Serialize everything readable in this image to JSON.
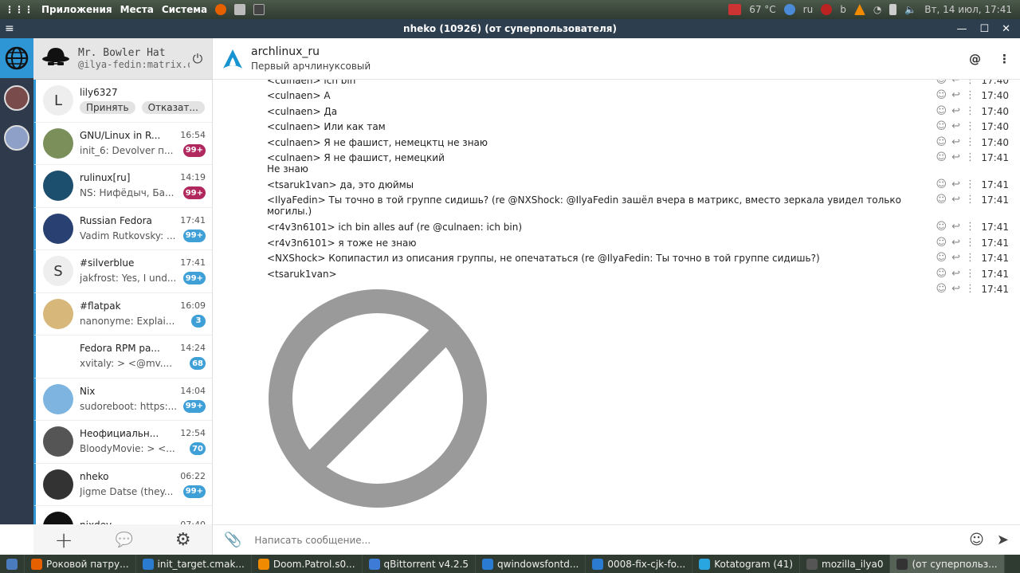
{
  "system_panel": {
    "menus": [
      "Приложения",
      "Места",
      "Система"
    ],
    "temperature": "67 °C",
    "keyboard_layout": "ru",
    "datetime": "Вт, 14 июл, 17:41",
    "tray_letter": "b"
  },
  "window": {
    "title": "nheko (10926) (от суперпользователя)",
    "hamburger": "≡",
    "min": "—",
    "max": "☐",
    "close": "✕"
  },
  "user": {
    "display_name": "Mr. Bowler Hat",
    "user_id": "@ilya-fedin:matrix.o",
    "logout_icon": "⏻"
  },
  "rooms": [
    {
      "name": "lily6327",
      "avatar_letter": "L",
      "invite": true,
      "accept": "Принять",
      "decline": "Отказат..."
    },
    {
      "name": "GNU/Linux in R...",
      "time": "16:54",
      "last": "init_6: Devolver п...",
      "badge": "99+",
      "badge_color": "#b0285d",
      "avatar_color": "#7a8f5a"
    },
    {
      "name": "rulinux[ru]",
      "time": "14:19",
      "last": "NS: Нифёдыч, Ба...",
      "badge": "99+",
      "badge_color": "#b0285d",
      "avatar_color": "#1c4f6e"
    },
    {
      "name": "Russian Fedora",
      "time": "17:41",
      "last": "Vadim Rutkovsky: ...",
      "badge": "99+",
      "badge_color": "#3fa0d8",
      "avatar_color": "#294172"
    },
    {
      "name": "#silverblue",
      "avatar_letter": "S",
      "time": "17:41",
      "last": "jakfrost: Yes, I und...",
      "badge": "99+",
      "badge_color": "#3fa0d8",
      "avatar_color": "#eeeeee"
    },
    {
      "name": "#flatpak",
      "time": "16:09",
      "last": "nanonyme: Explai...",
      "badge": "3",
      "badge_color": "#3fa0d8",
      "avatar_color": "#d8b87a"
    },
    {
      "name": "Fedora RPM pa...",
      "time": "14:24",
      "last": "xvitaly: > <@mv....",
      "badge": "68",
      "badge_color": "#3fa0d8",
      "avatar_color": "#ffffff"
    },
    {
      "name": "Nix",
      "time": "14:04",
      "last": "sudoreboot: https:...",
      "badge": "99+",
      "badge_color": "#3fa0d8",
      "avatar_color": "#7eb5e0"
    },
    {
      "name": "Неофициальн...",
      "time": "12:54",
      "last": "BloodyMovie: > <...",
      "badge": "70",
      "badge_color": "#3fa0d8",
      "avatar_color": "#555555"
    },
    {
      "name": "nheko",
      "time": "06:22",
      "last": "Jigme Datse (they...",
      "badge": "99+",
      "badge_color": "#3fa0d8",
      "avatar_color": "#333333"
    },
    {
      "name": "nixdev",
      "time": "07:40",
      "last": "",
      "badge": "",
      "badge_color": "#3fa0d8",
      "avatar_color": "#111111"
    }
  ],
  "room_toolbar": {
    "add": "+",
    "chat": "💬",
    "settings": "⚙"
  },
  "chat": {
    "room_name": "archlinux_ru",
    "room_topic": "Первый арчлинуксовый",
    "mention_icon": "@",
    "menu_icon": "⋮",
    "messages": [
      {
        "text": "<culnaen> ich bin",
        "time": "17:40"
      },
      {
        "text": "<culnaen> А",
        "time": "17:40"
      },
      {
        "text": "<culnaen> Да",
        "time": "17:40"
      },
      {
        "text": "<culnaen> Или как там",
        "time": "17:40"
      },
      {
        "text": "<culnaen> Я не фашист, немецктц не знаю",
        "time": "17:40"
      },
      {
        "text": "<culnaen> Я не фашист, немецкий",
        "text2": "Не знаю",
        "time": "17:41"
      },
      {
        "text": "<tsaruk1van> да, это дюймы",
        "time": "17:41"
      },
      {
        "text": "<IlyaFedin> Ты точно в той группе сидишь? (re @NXShock: @IlyaFedin зашёл вчера в матрикс, вместо зеркала увидел только",
        "text2": "могилы.)",
        "time": "17:41"
      },
      {
        "text": "<r4v3n6101> ich bin alles auf (re @culnaen: ich bin)",
        "time": "17:41"
      },
      {
        "text": "<r4v3n6101> я тоже не знаю",
        "time": "17:41"
      },
      {
        "text": "<NXShock> Копипастил из описания группы, не опечататься (re @IlyaFedin: Ты точно в той группе сидишь?)",
        "time": "17:41"
      },
      {
        "text": "<tsaruk1van>",
        "time": "17:41"
      },
      {
        "text": "",
        "time": "17:41"
      }
    ],
    "composer_placeholder": "Написать сообщение..."
  },
  "taskbar": [
    {
      "label": "Роковой патру...",
      "color": "#e66000"
    },
    {
      "label": "init_target.cmak...",
      "color": "#2b7bd1"
    },
    {
      "label": "Doom.Patrol.s0...",
      "color": "#f08a00"
    },
    {
      "label": "qBittorrent v4.2.5",
      "color": "#3d7bd6"
    },
    {
      "label": "qwindowsfontd...",
      "color": "#2b7bd1"
    },
    {
      "label": "0008-fix-cjk-fo...",
      "color": "#2b7bd1"
    },
    {
      "label": "Kotatogram (41)",
      "color": "#2ba5e0"
    },
    {
      "label": "mozilla_ilya0",
      "color": "#555555"
    },
    {
      "label": "(от суперпольз...",
      "color": "#333333",
      "active": true
    }
  ],
  "colors": {
    "accent": "#2e96d5",
    "title_bar": "#2d3e4f",
    "community_bar": "#2f3b4c"
  }
}
